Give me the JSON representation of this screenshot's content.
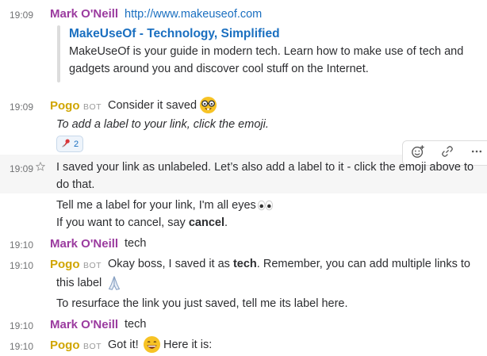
{
  "messages": {
    "m1": {
      "time": "19:09",
      "author": "Mark O'Neill",
      "link": "http://www.makeuseof.com"
    },
    "unfurl": {
      "title": "MakeUseOf - Technology, Simplified",
      "line1": "MakeUseOf is your guide in modern tech. Learn how to make use of tech and",
      "line2": "gadgets around you and discover cool stuff on the Internet."
    },
    "m2": {
      "time": "19:09",
      "author": "Pogo",
      "bot_badge": "BOT",
      "text": "Consider it saved",
      "hint": "To add a label to your link, click the emoji.",
      "reaction_count": "2"
    },
    "m3": {
      "time": "19:09",
      "line1": "I saved your link as unlabeled. Let’s also add a label to it - click the emoji above to",
      "line2": "do that.",
      "line3": "Tell me a label for your link, I'm all eyes",
      "line4_prefix": "If you want to cancel, say ",
      "line4_bold": "cancel",
      "line4_suffix": "."
    },
    "m4": {
      "time": "19:10",
      "author": "Mark O'Neill",
      "text": "tech"
    },
    "m5": {
      "time": "19:10",
      "author": "Pogo",
      "bot_badge": "BOT",
      "prefix": "Okay boss, I saved it as ",
      "bold": "tech",
      "suffix": ". Remember, you can add multiple links to",
      "line2": "this label",
      "line3": "To resurface the link you just saved, tell me its label here."
    },
    "m6": {
      "time": "19:10",
      "author": "Mark O'Neill",
      "text": "tech"
    },
    "m7": {
      "time": "19:10",
      "author": "Pogo",
      "bot_badge": "BOT",
      "text1": "Got it!",
      "text2": "Here it is:"
    }
  },
  "colors": {
    "mark_name": "#9b3b9f",
    "pogo_name": "#d0a500",
    "link": "#1a6fc0"
  },
  "icons": [
    "nerd-face-icon",
    "pushpin-icon",
    "eyes-icon",
    "praying-hands-icon",
    "grinning-face-icon",
    "add-reaction-icon",
    "link-icon",
    "more-actions-icon",
    "star-icon"
  ]
}
